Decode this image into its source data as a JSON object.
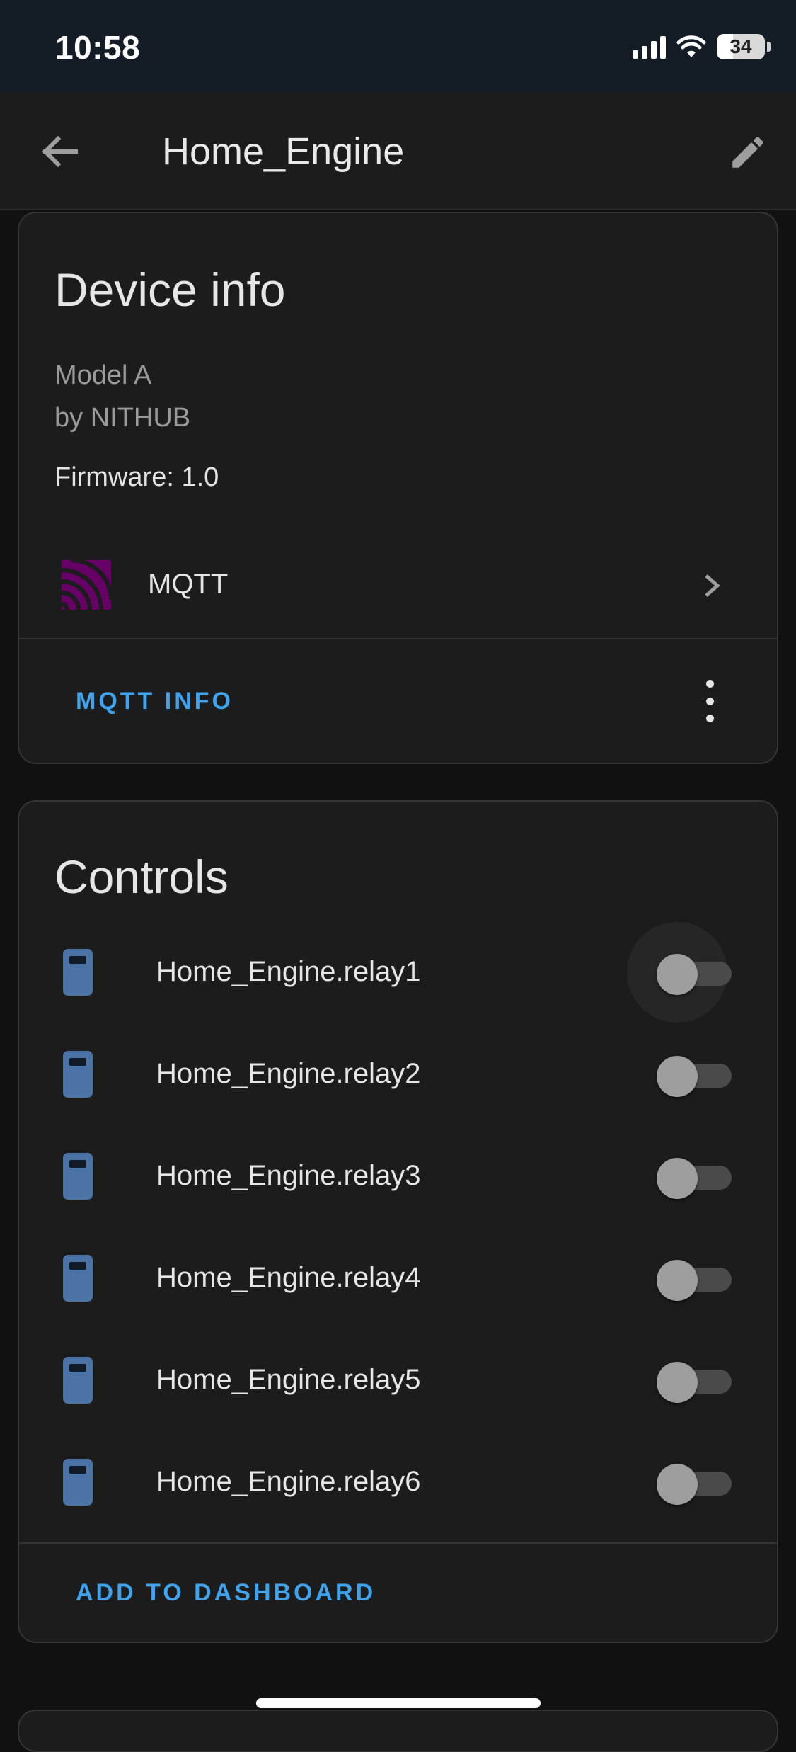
{
  "status_bar": {
    "time": "10:58",
    "battery": "34"
  },
  "app_bar": {
    "title": "Home_Engine",
    "back_icon": "arrow-left-icon",
    "edit_icon": "pencil-icon"
  },
  "device_info": {
    "title": "Device info",
    "model": "Model A",
    "manufacturer": "by NITHUB",
    "firmware": "Firmware: 1.0",
    "integration": {
      "label": "MQTT",
      "icon": "mqtt-logo-icon",
      "icon_color": "#660066"
    },
    "action_label": "MQTT INFO"
  },
  "controls": {
    "title": "Controls",
    "items": [
      {
        "label": "Home_Engine.relay1",
        "on": false
      },
      {
        "label": "Home_Engine.relay2",
        "on": false
      },
      {
        "label": "Home_Engine.relay3",
        "on": false
      },
      {
        "label": "Home_Engine.relay4",
        "on": false
      },
      {
        "label": "Home_Engine.relay5",
        "on": false
      },
      {
        "label": "Home_Engine.relay6",
        "on": false
      }
    ],
    "action_label": "ADD TO DASHBOARD"
  },
  "colors": {
    "accent": "#3fa3ee",
    "card_background": "#1c1c1c",
    "relay_icon": "#4c73a5"
  }
}
